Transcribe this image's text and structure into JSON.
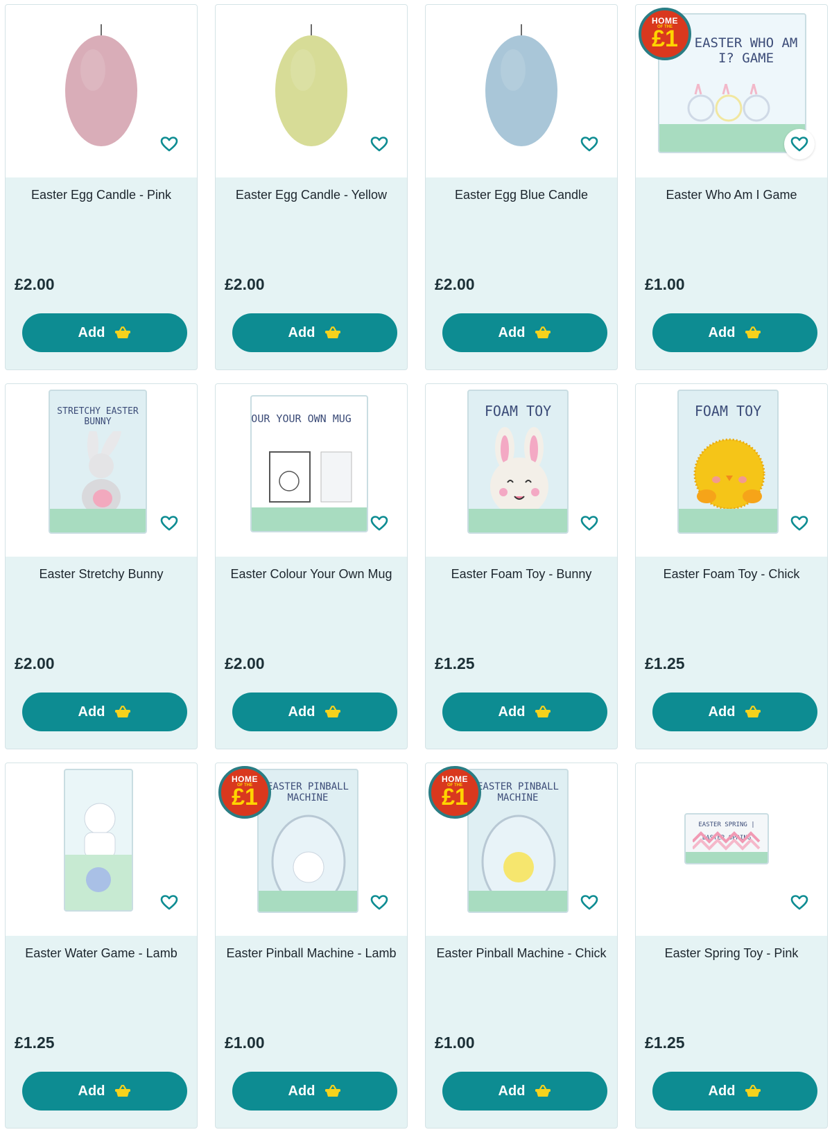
{
  "products": [
    {
      "title": "Easter Egg Candle - Pink",
      "price": "£2.00",
      "add_label": "Add",
      "image": "egg-candle",
      "color": "#d9adb8"
    },
    {
      "title": "Easter Egg Candle - Yellow",
      "price": "£2.00",
      "add_label": "Add",
      "image": "egg-candle",
      "color": "#d7dc97"
    },
    {
      "title": "Easter Egg Blue Candle",
      "price": "£2.00",
      "add_label": "Add",
      "image": "egg-candle",
      "color": "#a9c6d8"
    },
    {
      "title": "Easter Who Am I Game",
      "price": "£1.00",
      "add_label": "Add",
      "image": "game-pack",
      "pack_text": "EASTER WHO AM I? GAME",
      "badge": true
    },
    {
      "title": "Easter Stretchy Bunny",
      "price": "£2.00",
      "add_label": "Add",
      "image": "bunny-pack",
      "pack_text": "STRETCHY EASTER BUNNY"
    },
    {
      "title": "Easter Colour Your Own Mug",
      "price": "£2.00",
      "add_label": "Add",
      "image": "mug-box",
      "pack_text": "COLOUR YOUR OWN MUG"
    },
    {
      "title": "Easter Foam Toy - Bunny",
      "price": "£1.25",
      "add_label": "Add",
      "image": "foam-bunny",
      "pack_text": "FOAM TOY"
    },
    {
      "title": "Easter Foam Toy - Chick",
      "price": "£1.25",
      "add_label": "Add",
      "image": "foam-chick",
      "pack_text": "FOAM TOY"
    },
    {
      "title": "Easter Water Game - Lamb",
      "price": "£1.25",
      "add_label": "Add",
      "image": "water-game"
    },
    {
      "title": "Easter Pinball Machine - Lamb",
      "price": "£1.00",
      "add_label": "Add",
      "image": "pinball-lamb",
      "pack_text": "EASTER PINBALL MACHINE",
      "badge": true
    },
    {
      "title": "Easter Pinball Machine - Chick",
      "price": "£1.00",
      "add_label": "Add",
      "image": "pinball-chick",
      "pack_text": "EASTER PINBALL MACHINE",
      "badge": true
    },
    {
      "title": "Easter Spring Toy - Pink",
      "price": "£1.25",
      "add_label": "Add",
      "image": "spring-toy",
      "pack_text": "EASTER SPRING"
    }
  ],
  "badge": {
    "line1": "HOME",
    "line2": "OF THE",
    "line3": "£1"
  },
  "icons": {
    "favourite": "heart-outline-icon",
    "basket": "basket-icon"
  },
  "colors": {
    "accent": "#0d8c92",
    "card_bg": "#e5f3f4",
    "basket": "#f6d21c",
    "heart": "#0d8c92"
  }
}
